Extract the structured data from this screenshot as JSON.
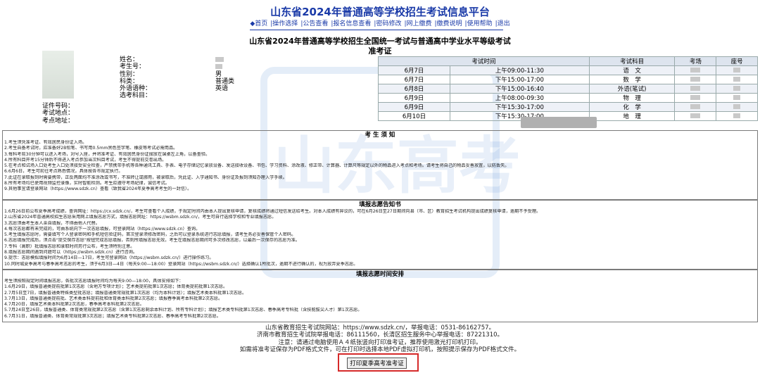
{
  "site_title": "山东省2024年普通高等学校招生考试信息平台",
  "nav": [
    "◆首页",
    "|操作选择",
    "|公告查看",
    "|报名信息查看",
    "|密码修改",
    "|网上缴费",
    "|缴费说明",
    "|使用帮助",
    "|退出"
  ],
  "doc_title_1": "山东省2024年普通高等学校招生全国统一考试与普通高中学业水平等级考试",
  "doc_title_2": "准考证",
  "info_labels": [
    "姓名：",
    "考生号：",
    "性别：",
    "科类：",
    "外语语种：",
    "选考科目："
  ],
  "info_values": {
    "gender": "男",
    "category": "普通类",
    "language": "英语"
  },
  "info_labels2": [
    "证件号码：",
    "考试地点：",
    "考点地址："
  ],
  "schedule_headers": [
    "考试时间",
    "考试科目",
    "考场",
    "座号"
  ],
  "schedule": [
    {
      "date": "6月7日",
      "time": "上午09:00-11:30",
      "subject": "语　文"
    },
    {
      "date": "6月7日",
      "time": "下午15:00-17:00",
      "subject": "数　学"
    },
    {
      "date": "6月8日",
      "time": "下午15:00-16:40",
      "subject": "外语(笔试)"
    },
    {
      "date": "6月9日",
      "time": "上午08:00-09:30",
      "subject": "物　理"
    },
    {
      "date": "6月9日",
      "time": "下午15:30-17:00",
      "subject": "化　学"
    },
    {
      "date": "6月10日",
      "time": "下午15:30-17:00",
      "subject": "地　理"
    }
  ],
  "sec1_title": "考 生 须 知",
  "sec1_lines": [
    "1.考生须凭准考证、有效居民身份证入场。",
    "2.考生自备考试时，应准备好2B铅笔、书写用0.5mm黑色签字笔、橡皮等考试必需用品。",
    "3.每科考前30分钟可以进入考场，对号入座，并将准考证、有效居民身份证摆放在课桌左上角，以备查验。",
    "4.所有科目开考15分钟后不得进入考点参加当次科目考试，考生不得提前交卷出场。",
    "5.在考点和试场入口处考生入口处须接受安全检查，严禁携带手机等各种通讯工具、手表、电子存储记忆录放设备、发送接收设备、书包、学习资料、涂改液、修正带、计算器、计算尺等规定以外的物品进入考点和考场。请考生将自己的物品妥善放置，以防丢失。",
    "6.6月6日，考生可前往考点熟悉情况，具体按各市规定执行。",
    "7.此证在录取报到时需要携带，正反两面均不准涂改或书写，不准转让或挪用，被录取后，凭此证、入学通知书、身份证及报到须知办理入学手续。",
    "8.所有考场均已使用视频监控录像，实时智能检测。考生应遵守考场纪律，诚信考试。",
    "9.其他事宜请登录网站（https://www.sdzk.cn）查看（致我省2024年夏季高考考生的一封信）。"
  ],
  "sec2_title": "填报志愿告知书",
  "sec2_lines": [
    "1.6月26日前公布夏季高考成绩，查询网址：https://cx.sdzk.cn/，考生可查看个人成绩，于规定时间内由本人提出复核申请，复核成绩将通过短信发送给考生。对本人成绩有异议的，可在6月26日至27日期间向县（市、区）教育招生考试机构提出成绩复核申请，逾期不予受理。",
    "2.山东省2024年普通高校招生志愿采用网上填报志愿方式，填报志愿网址：https://wsbm.sdzk.cn/，考生可自行选择学校和专业填报志愿。",
    "3.志愿须由考生本人亲自填报，不得由他人代替。",
    "4.每次志愿都有未完成的，可由系统向下一次志愿填报，可登录网站（https://www.sdzk.cn）查询。",
    "5.考生填报志愿时，需要填写个人登录密码和手机短信验证码，首次登录须修改密码，之后可以登录系统进行志愿填报，请考生务必妥善保管个人密码。",
    "6.志愿填报完成后，须点击\"提交保存志愿\"按钮完成志愿填报，否则所填报志愿无效，考生在填报志愿期间可多次修改志愿，以最后一次保存的志愿为准。",
    "7.专科（高职）批填报志愿和录取时间另行公布，考生须特别注意。",
    "8.填报志愿期间遇到问题可以（https://wsbm.sdzk.cn）进行咨询。",
    "9.提示：志愿模拟填报时间为6月14日—17日，考生可登录网站（https://wsbm.sdzk.cn/）进行操作练习。",
    "10.同时城夏季高考与春季高考志愿的考生，须于6月3日—4日（每天9:00—18:00）登录网站（https://wsbm.sdzk.cn/）选择确认1所批次，逾期不进行确认的，视为放弃夏季志愿。"
  ],
  "sec3_title": "填报志愿时间安排",
  "sec3_lines": [
    "考生须按照规定时间填报志愿，各批次志愿填报时间均为每天9:00—18:00，具体安排如下：",
    "1.6月29日，填报普通类提前批第1次志愿（含地方专项计划）；艺术类提前批第1次志愿；体育类提前批第1次志愿。",
    "2.7月5日至7日，填报普通类特殊类型批志愿；填报普通类常规批第1次志愿（均为本科计划）；填报艺术类本科批第1次志愿。",
    "3.7月13日，填报普通类提前批、艺术类本科提前批和体育类本科批第2次志愿；填报春季高考本科批第2次志愿。",
    "4.7月20日，填报艺术类本科批第2次志愿，春季高考本科批第2次志愿。",
    "5.7月24日至26日，填报普通类、体育类常规批第2次志愿（含第1次志愿剩余本科计划、所有专科计划）；填报艺术类专科批第1次志愿、春季高考专科批（含技能拔尖人才）第1次志愿。",
    "6.7月31日，填报普通类、体育类常规批第3次志愿；填报艺术类专科批第2次志愿、春季高考专科批第2次志愿。"
  ],
  "footer_lines": [
    "山东省教育招生考试院网站：https://www.sdzk.cn/，举报电话：0531-86162757。",
    "济南市教育招生考试院举报电话：86111560，长清区招生服务中心举报电话：87221310。",
    "注意：请通过电脑使用Ａ４纸张竖向打印准考证，推荐使用激光打印机打印。",
    "如需将准考证保存为PDF格式文件，可在打印时选择本地PDF虚拟打印机，按照提示保存为PDF格式文件。"
  ],
  "print_button": "打印夏季高考准考证",
  "watermark_text": "山东高考",
  "colors": {
    "brand": "#1a3aa8",
    "highlight": "#d62a2a"
  }
}
